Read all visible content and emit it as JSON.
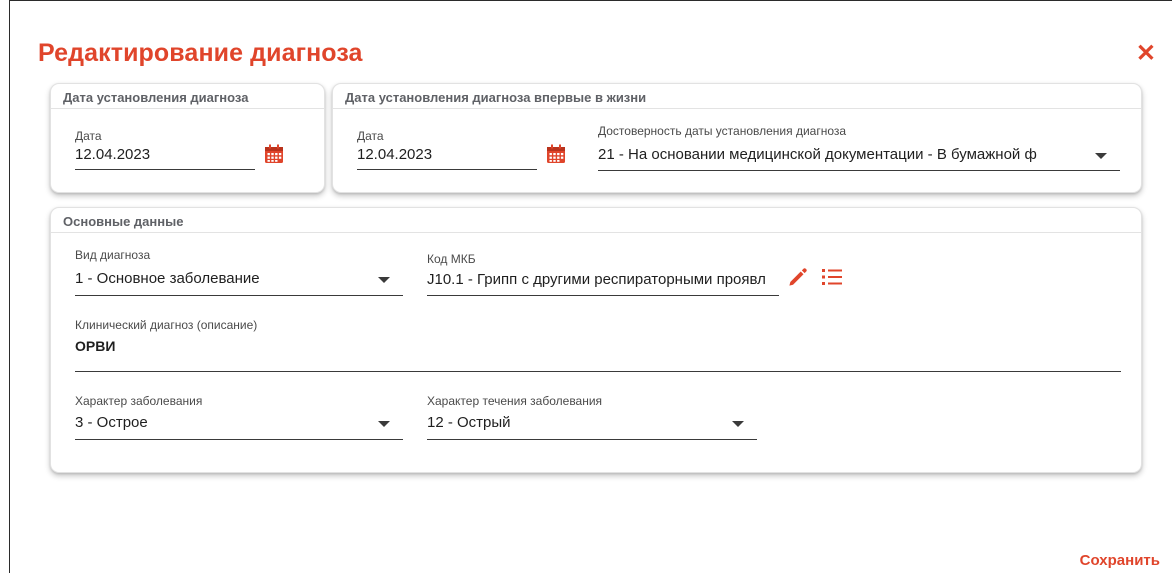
{
  "dialog": {
    "title": "Редактирование диагноза",
    "close_icon": "close-icon",
    "save_label": "Сохранить",
    "accent_color": "#e0452b"
  },
  "card_date": {
    "header": "Дата установления диагноза",
    "date_label": "Дата",
    "date_value": "12.04.2023",
    "calendar_icon": "calendar-icon"
  },
  "card_first": {
    "header": "Дата установления диагноза впервые в жизни",
    "date_label": "Дата",
    "date_value": "12.04.2023",
    "reliability_label": "Достоверность даты установления диагноза",
    "reliability_value": "21 - На основании медицинской документации - В бумажной ф"
  },
  "card_main": {
    "header": "Основные данные",
    "diag_type_label": "Вид диагноза",
    "diag_type_value": "1 - Основное заболевание",
    "mkb_label": "Код МКБ",
    "mkb_value": "J10.1 - Грипп с другими респираторными проявл",
    "mkb_edit_icon": "pencil-icon",
    "mkb_list_icon": "list-icon",
    "clinical_label": "Клинический диагноз (описание)",
    "clinical_value": "ОРВИ",
    "disease_nature_label": "Характер заболевания",
    "disease_nature_value": "3 - Острое",
    "course_label": "Характер течения заболевания",
    "course_value": "12 - Острый"
  }
}
